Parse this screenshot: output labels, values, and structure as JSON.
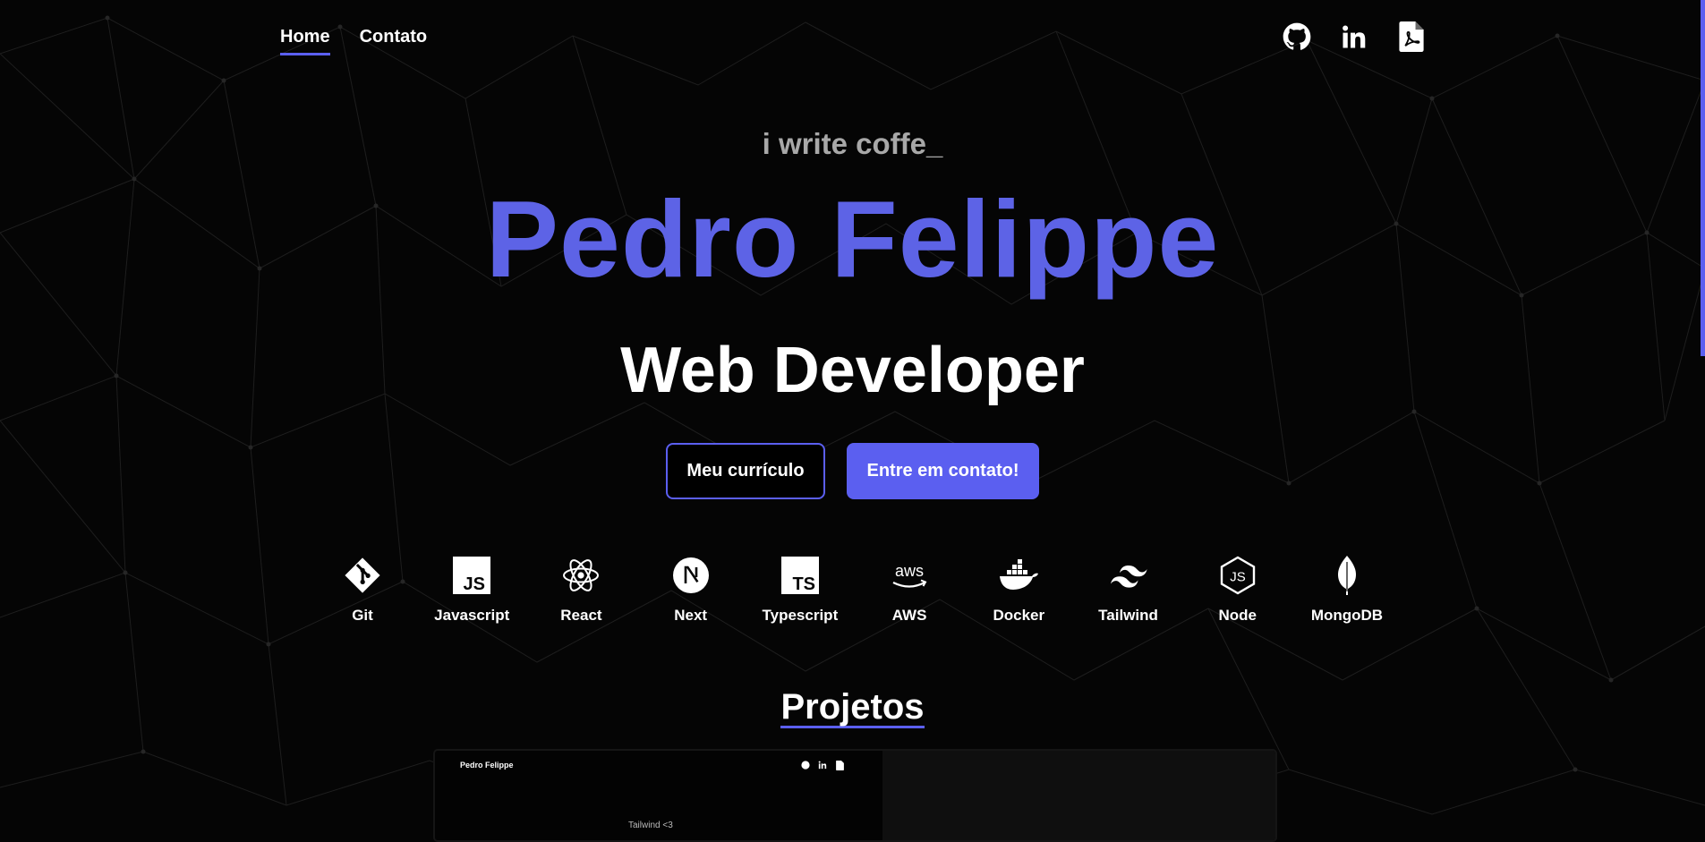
{
  "nav": {
    "items": [
      {
        "label": "Home",
        "active": true
      },
      {
        "label": "Contato",
        "active": false
      }
    ]
  },
  "socials": [
    {
      "icon": "github-icon",
      "label": "GitHub"
    },
    {
      "icon": "linkedin-icon",
      "label": "LinkedIn"
    },
    {
      "icon": "pdf-icon",
      "label": "Currículo PDF"
    }
  ],
  "hero": {
    "tagline": "i write coffe_",
    "name": "Pedro Felippe",
    "role": "Web Developer",
    "primary_button": "Meu currículo",
    "secondary_button": "Entre em contato!"
  },
  "skills": [
    {
      "label": "Git",
      "icon": "git-icon"
    },
    {
      "label": "Javascript",
      "icon": "javascript-icon"
    },
    {
      "label": "React",
      "icon": "react-icon"
    },
    {
      "label": "Next",
      "icon": "nextjs-icon"
    },
    {
      "label": "Typescript",
      "icon": "typescript-icon"
    },
    {
      "label": "AWS",
      "icon": "aws-icon"
    },
    {
      "label": "Docker",
      "icon": "docker-icon"
    },
    {
      "label": "Tailwind",
      "icon": "tailwind-icon"
    },
    {
      "label": "Node",
      "icon": "nodejs-icon"
    },
    {
      "label": "MongoDB",
      "icon": "mongodb-icon"
    }
  ],
  "projects": {
    "title": "Projetos",
    "first_card": {
      "preview_name": "Pedro Felippe",
      "preview_caption": "Tailwind <3"
    }
  },
  "colors": {
    "accent": "#5b5ff0",
    "background": "#050505",
    "name_color": "#5d63e6",
    "tagline_color": "#a8a8a8"
  }
}
